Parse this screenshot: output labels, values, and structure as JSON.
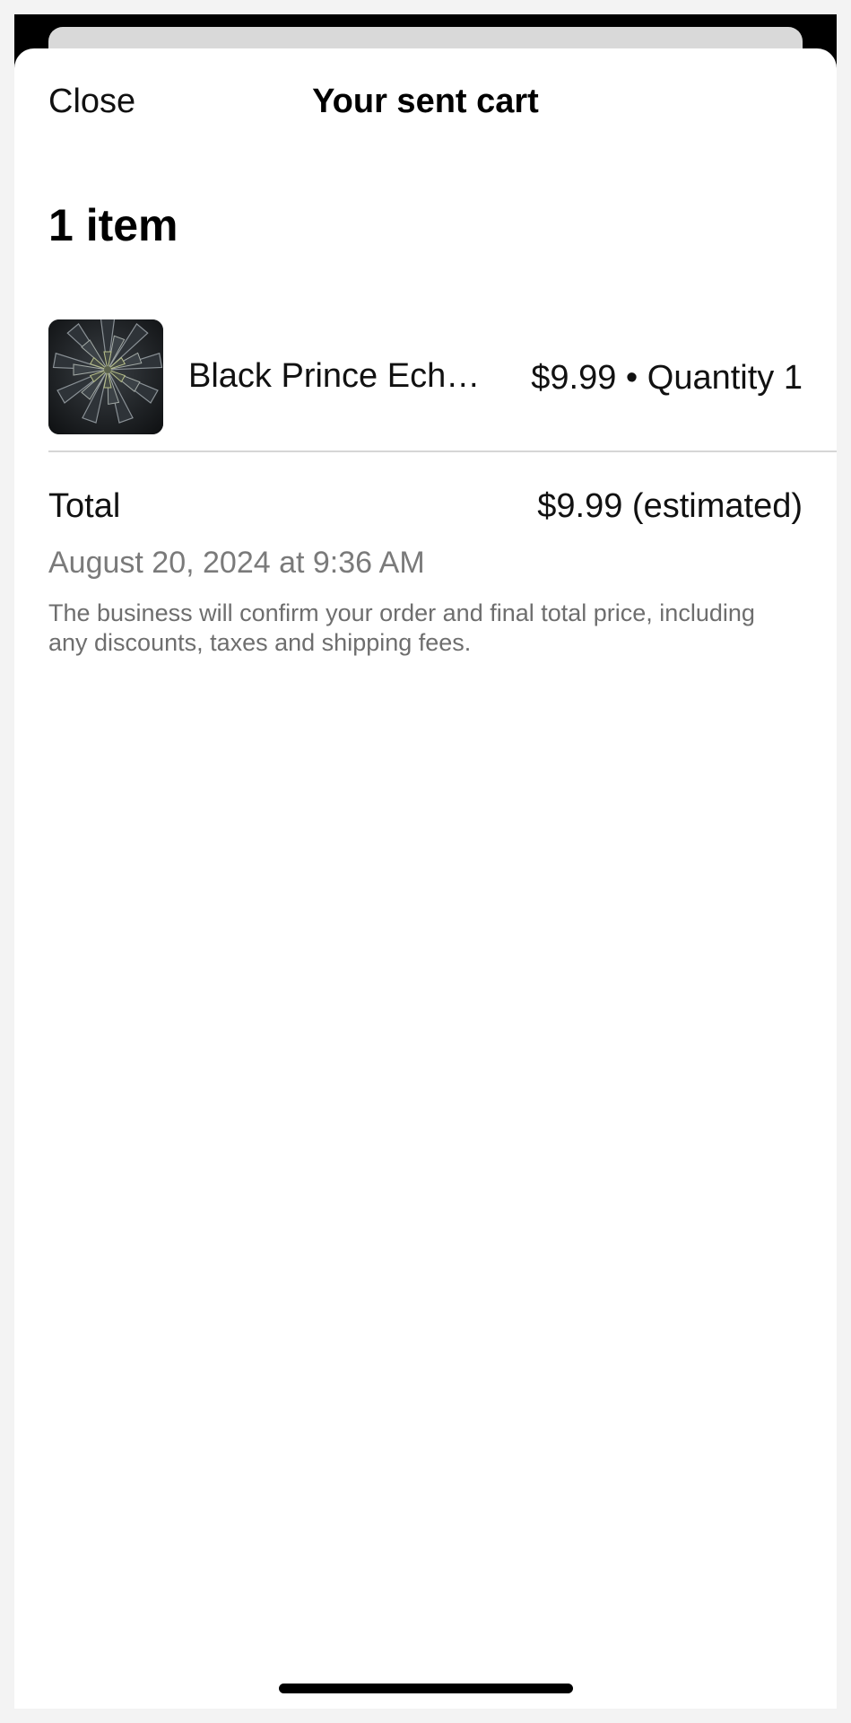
{
  "nav": {
    "close_label": "Close",
    "title": "Your sent cart"
  },
  "cart": {
    "item_count_label": "1 item",
    "items": [
      {
        "name": "Black Prince Ech…",
        "price": "$9.99",
        "separator": "•",
        "quantity": "Quantity 1"
      }
    ],
    "total_label": "Total",
    "total_value": "$9.99 (estimated)",
    "timestamp": "August 20, 2024 at 9:36 AM",
    "note": "The business will confirm your order and final total price, including any discounts, taxes and shipping fees."
  }
}
